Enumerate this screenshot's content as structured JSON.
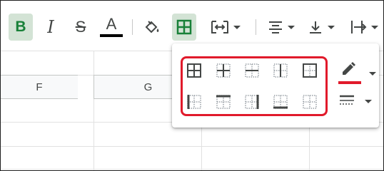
{
  "toolbar": {
    "bold_label": "B",
    "italic_label": "I",
    "strike_label": "S",
    "textcolor_label": "A",
    "textcolor_hex": "#000000",
    "accent_active_bg": "#d3e3d5",
    "accent_green": "#188038"
  },
  "sheet": {
    "columns": [
      "F",
      "G"
    ]
  },
  "borders_popup": {
    "highlight_color": "#e11a2b",
    "pen_color": "#e11a2b",
    "row1": [
      "all-borders",
      "inner-borders",
      "horizontal-borders",
      "vertical-borders",
      "outer-borders"
    ],
    "row2": [
      "left-border",
      "top-border",
      "right-border",
      "bottom-border",
      "clear-borders"
    ]
  }
}
